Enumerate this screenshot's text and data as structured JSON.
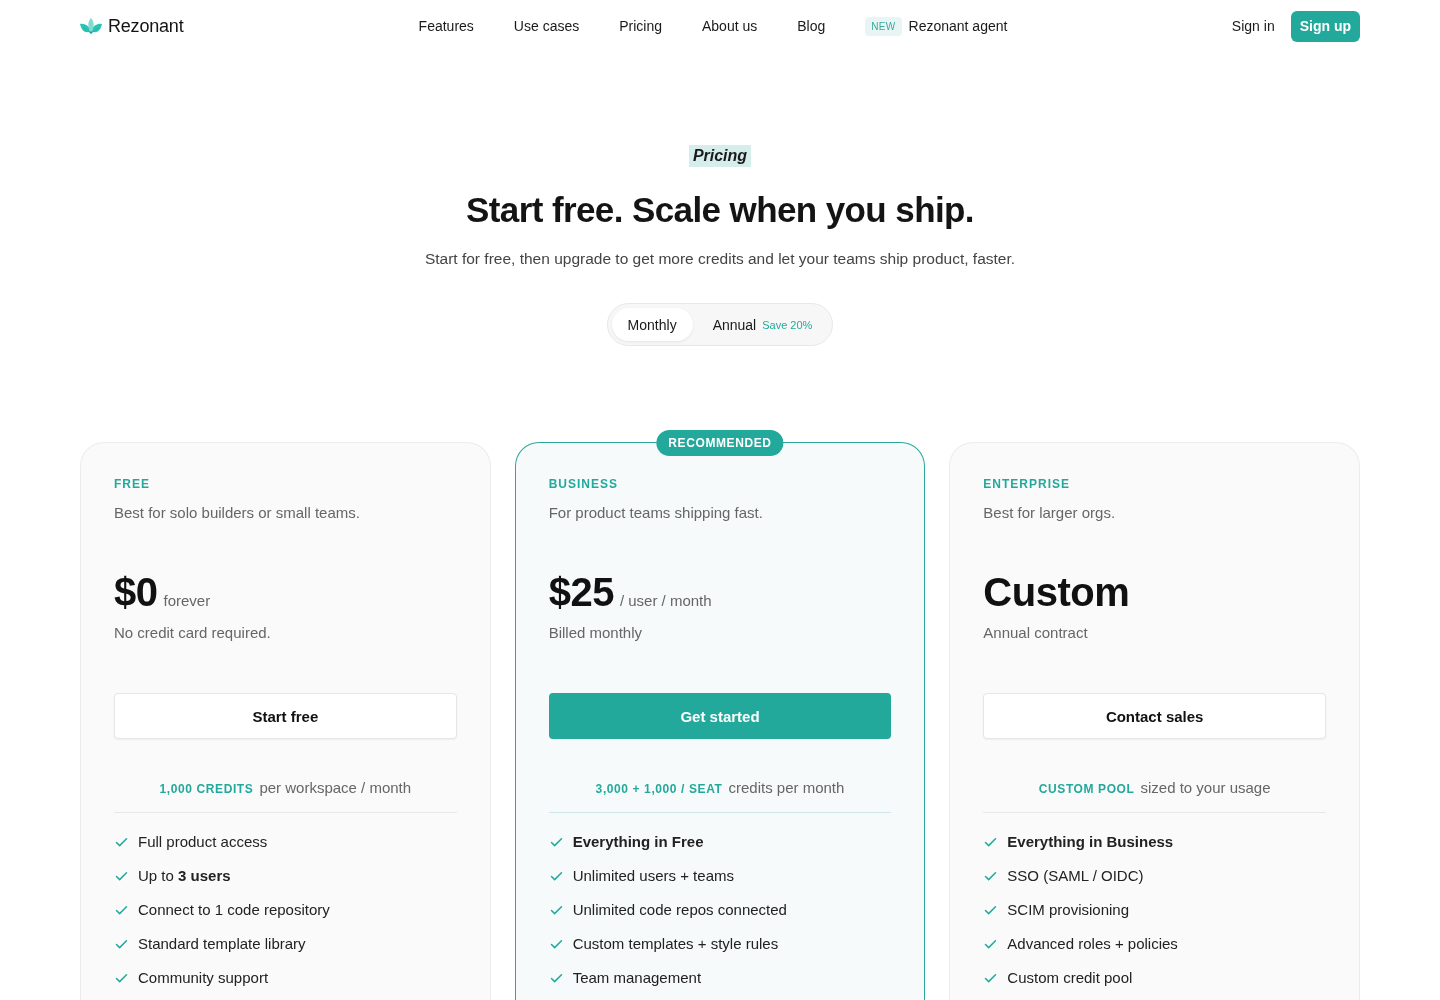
{
  "nav": {
    "brand": "Rezonant",
    "links": [
      {
        "label": "Features"
      },
      {
        "label": "Use cases"
      },
      {
        "label": "Pricing"
      },
      {
        "label": "About us"
      },
      {
        "label": "Blog"
      },
      {
        "label": "Rezonant agent",
        "badge": "NEW"
      }
    ],
    "sign_in": "Sign in",
    "sign_up": "Sign up"
  },
  "hero": {
    "eyebrow": "Pricing",
    "title": "Start free. Scale when you ship.",
    "subtitle": "Start for free, then upgrade to get more credits and let your teams ship product, faster."
  },
  "billing_toggle": [
    {
      "label": "Monthly",
      "selected": true
    },
    {
      "label": "Annual",
      "selected": false,
      "note": "Save 20%"
    }
  ],
  "plans": [
    {
      "recommended": false,
      "tier": "FREE",
      "description": "Best for solo builders or small teams.",
      "price": "$0",
      "period": "forever",
      "price_note": "No credit card required.",
      "button": {
        "label": "Start free",
        "kind": "secondary"
      },
      "credits": {
        "amount": "1,000 CREDITS",
        "text": "per workspace / month"
      },
      "features": [
        {
          "text": "Full product access",
          "kind": "item"
        },
        {
          "text": "Up to **3 users**",
          "kind": "item"
        },
        {
          "text": "Connect to 1 code repository",
          "kind": "item"
        },
        {
          "text": "Standard template library",
          "kind": "item"
        },
        {
          "text": "Community support",
          "kind": "item"
        }
      ]
    },
    {
      "recommended": true,
      "badge": "RECOMMENDED",
      "tier": "BUSINESS",
      "description": "For product teams shipping fast.",
      "price": "$25",
      "period": "/ user / month",
      "price_note": "Billed monthly",
      "button": {
        "label": "Get started",
        "kind": "primary"
      },
      "credits": {
        "amount": "3,000 + 1,000 / SEAT",
        "text": "credits per month"
      },
      "features": [
        {
          "text": "Everything in Free",
          "kind": "summary"
        },
        {
          "text": "Unlimited users + teams",
          "kind": "item"
        },
        {
          "text": "Unlimited code repos connected",
          "kind": "item"
        },
        {
          "text": "Custom templates + style rules",
          "kind": "item"
        },
        {
          "text": "Team management",
          "kind": "item"
        }
      ]
    },
    {
      "recommended": false,
      "tier": "ENTERPRISE",
      "description": "Best for larger orgs.",
      "price": "Custom",
      "price_note": "Annual contract",
      "button": {
        "label": "Contact sales",
        "kind": "secondary"
      },
      "credits": {
        "amount": "CUSTOM POOL",
        "text": "sized to your usage"
      },
      "features": [
        {
          "text": "Everything in Business",
          "kind": "summary"
        },
        {
          "text": "SSO (SAML / OIDC)",
          "kind": "item"
        },
        {
          "text": "SCIM provisioning",
          "kind": "item"
        },
        {
          "text": "Advanced roles + policies",
          "kind": "item"
        },
        {
          "text": "Custom credit pool",
          "kind": "item"
        }
      ]
    }
  ]
}
